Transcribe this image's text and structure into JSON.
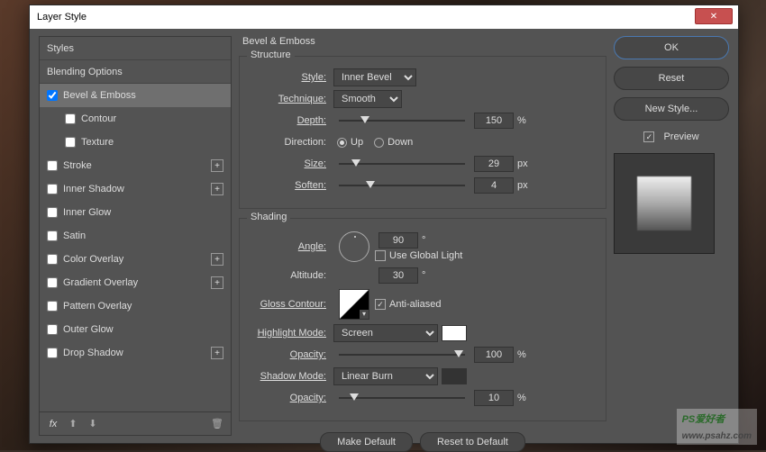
{
  "window": {
    "title": "Layer Style"
  },
  "sidebar": {
    "items": [
      {
        "label": "Styles",
        "type": "header"
      },
      {
        "label": "Blending Options",
        "type": "header"
      },
      {
        "label": "Bevel & Emboss",
        "checked": true,
        "selected": true
      },
      {
        "label": "Contour",
        "checked": false,
        "indent": true
      },
      {
        "label": "Texture",
        "checked": false,
        "indent": true
      },
      {
        "label": "Stroke",
        "checked": false,
        "add": true
      },
      {
        "label": "Inner Shadow",
        "checked": false,
        "add": true
      },
      {
        "label": "Inner Glow",
        "checked": false
      },
      {
        "label": "Satin",
        "checked": false
      },
      {
        "label": "Color Overlay",
        "checked": false,
        "add": true
      },
      {
        "label": "Gradient Overlay",
        "checked": false,
        "add": true
      },
      {
        "label": "Pattern Overlay",
        "checked": false
      },
      {
        "label": "Outer Glow",
        "checked": false
      },
      {
        "label": "Drop Shadow",
        "checked": false,
        "add": true
      }
    ],
    "fx_label": "fx"
  },
  "panel": {
    "title": "Bevel & Emboss",
    "structure": {
      "title": "Structure",
      "style_label": "Style:",
      "style_value": "Inner Bevel",
      "technique_label": "Technique:",
      "technique_value": "Smooth",
      "depth_label": "Depth:",
      "depth_value": "150",
      "depth_unit": "%",
      "direction_label": "Direction:",
      "up": "Up",
      "down": "Down",
      "size_label": "Size:",
      "size_value": "29",
      "size_unit": "px",
      "soften_label": "Soften:",
      "soften_value": "4",
      "soften_unit": "px"
    },
    "shading": {
      "title": "Shading",
      "angle_label": "Angle:",
      "angle_value": "90",
      "deg": "°",
      "global_light": "Use Global Light",
      "altitude_label": "Altitude:",
      "altitude_value": "30",
      "gloss_label": "Gloss Contour:",
      "antialiased": "Anti-aliased",
      "highlight_label": "Highlight Mode:",
      "highlight_value": "Screen",
      "opacity_label": "Opacity:",
      "highlight_opacity": "100",
      "shadow_label": "Shadow Mode:",
      "shadow_value": "Linear Burn",
      "shadow_opacity": "10",
      "pct": "%"
    },
    "make_default": "Make Default",
    "reset_default": "Reset to Default"
  },
  "right": {
    "ok": "OK",
    "reset": "Reset",
    "new_style": "New Style...",
    "preview": "Preview"
  },
  "watermark": {
    "brand": "PS",
    "text": "爱好者",
    "url": "www.psahz.com"
  }
}
